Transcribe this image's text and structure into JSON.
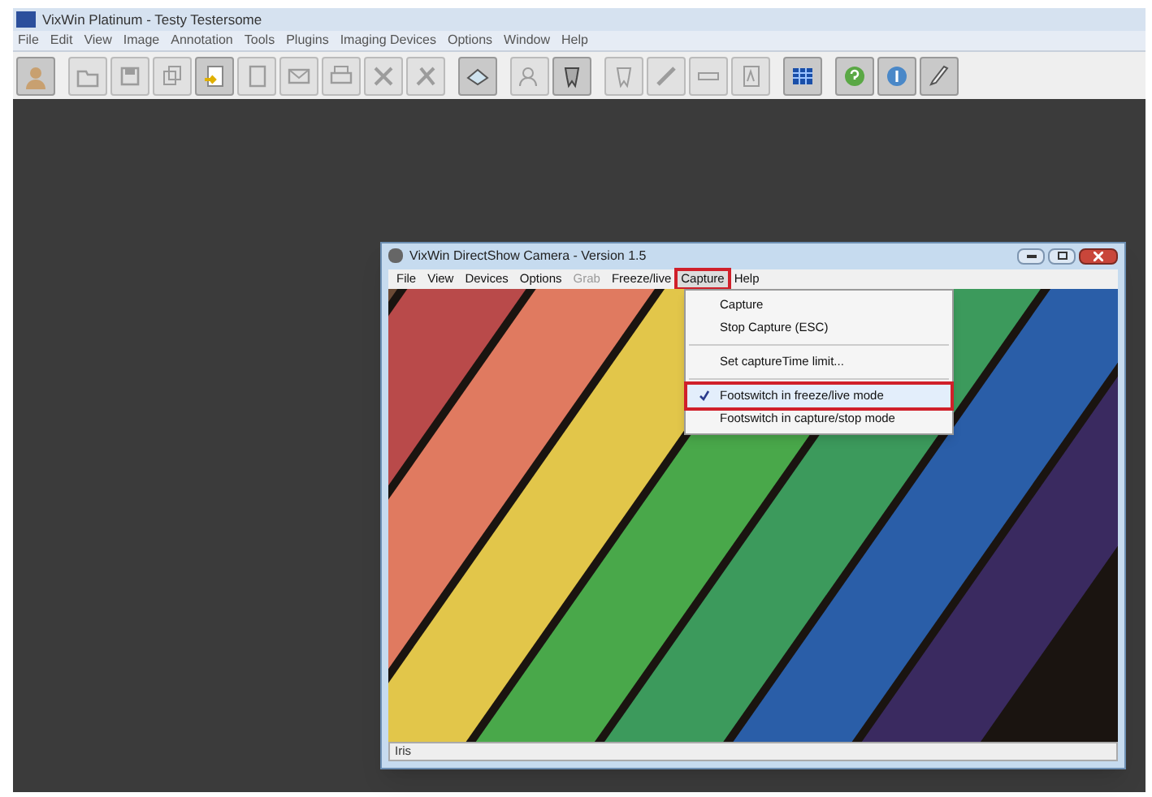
{
  "app": {
    "title": "VixWin Platinum - Testy Testersome",
    "menu": [
      "File",
      "Edit",
      "View",
      "Image",
      "Annotation",
      "Tools",
      "Plugins",
      "Imaging Devices",
      "Options",
      "Window",
      "Help"
    ],
    "toolbar": [
      [
        {
          "disabled": false
        }
      ],
      [
        {
          "disabled": true
        },
        {
          "disabled": true
        },
        {
          "disabled": true
        },
        {
          "disabled": false
        },
        {
          "disabled": true
        },
        {
          "disabled": true
        },
        {
          "disabled": true
        },
        {
          "disabled": true
        },
        {
          "disabled": true
        }
      ],
      [
        {
          "disabled": false
        }
      ],
      [
        {
          "disabled": true
        },
        {
          "disabled": false
        }
      ],
      [
        {
          "disabled": true
        },
        {
          "disabled": true
        },
        {
          "disabled": true
        },
        {
          "disabled": true
        }
      ],
      [
        {
          "disabled": false
        }
      ],
      [
        {
          "disabled": false
        },
        {
          "disabled": false
        },
        {
          "disabled": false
        }
      ]
    ]
  },
  "camera_window": {
    "title": "VixWin DirectShow Camera - Version 1.5",
    "menu": [
      {
        "label": "File",
        "disabled": false,
        "selected": false,
        "annotated": false
      },
      {
        "label": "View",
        "disabled": false,
        "selected": false,
        "annotated": false
      },
      {
        "label": "Devices",
        "disabled": false,
        "selected": false,
        "annotated": false
      },
      {
        "label": "Options",
        "disabled": false,
        "selected": false,
        "annotated": false
      },
      {
        "label": "Grab",
        "disabled": true,
        "selected": false,
        "annotated": false
      },
      {
        "label": "Freeze/live",
        "disabled": false,
        "selected": false,
        "annotated": false
      },
      {
        "label": "Capture",
        "disabled": false,
        "selected": true,
        "annotated": true
      },
      {
        "label": "Help",
        "disabled": false,
        "selected": false,
        "annotated": false
      }
    ],
    "dropdown": [
      {
        "kind": "item",
        "label": "Capture",
        "checked": false,
        "highlighted": false,
        "annotated": false
      },
      {
        "kind": "item",
        "label": "Stop Capture (ESC)",
        "checked": false,
        "highlighted": false,
        "annotated": false
      },
      {
        "kind": "separator"
      },
      {
        "kind": "item",
        "label": "Set captureTime limit...",
        "checked": false,
        "highlighted": false,
        "annotated": false
      },
      {
        "kind": "separator"
      },
      {
        "kind": "item",
        "label": "Footswitch in freeze/live mode",
        "checked": true,
        "highlighted": true,
        "annotated": true
      },
      {
        "kind": "item",
        "label": "Footswitch in capture/stop mode",
        "checked": false,
        "highlighted": false,
        "annotated": false
      }
    ],
    "status": "Iris"
  }
}
